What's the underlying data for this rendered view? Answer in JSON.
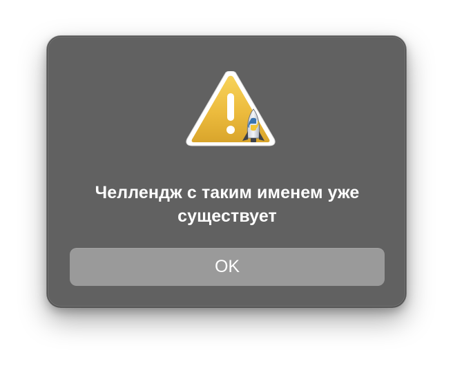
{
  "dialog": {
    "icon": "warning-triangle-with-python-rocket-icon",
    "message": "Челлендж с таким именем уже существует",
    "ok_label": "OK"
  },
  "colors": {
    "dialog_bg": "#616161",
    "button_bg": "#9a9a9a",
    "warning_yellow": "#e9b83a",
    "text": "#ffffff"
  }
}
